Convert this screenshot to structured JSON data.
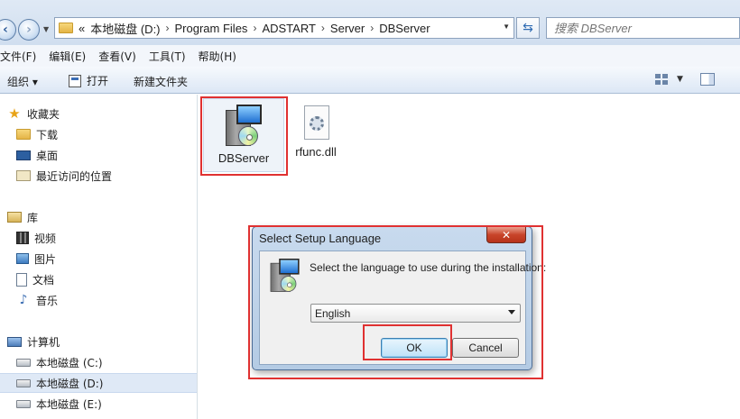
{
  "address_bar": {
    "overflow_chevron": "«",
    "crumbs": [
      "本地磁盘 (D:)",
      "Program Files",
      "ADSTART",
      "Server",
      "DBServer"
    ],
    "separator": "›",
    "search_placeholder": "搜索 DBServer"
  },
  "menu": {
    "items": [
      "文件(F)",
      "编辑(E)",
      "查看(V)",
      "工具(T)",
      "帮助(H)"
    ]
  },
  "toolbar": {
    "organize": "组织 ▾",
    "open": "打开",
    "new_folder": "新建文件夹"
  },
  "sidebar": {
    "favorites": {
      "label": "收藏夹",
      "items": [
        "下载",
        "桌面",
        "最近访问的位置"
      ]
    },
    "libraries": {
      "label": "库",
      "items": [
        "视频",
        "图片",
        "文档",
        "音乐"
      ]
    },
    "computer": {
      "label": "计算机",
      "items": [
        "本地磁盘 (C:)",
        "本地磁盘 (D:)",
        "本地磁盘 (E:)"
      ],
      "selected_index": 1
    }
  },
  "files": [
    {
      "name": "DBServer",
      "icon": "setup-installer-icon"
    },
    {
      "name": "rfunc.dll",
      "icon": "dll-gear-icon"
    }
  ],
  "dialog": {
    "title": "Select Setup Language",
    "close_glyph": "✕",
    "prompt": "Select the language to use during the installation:",
    "language_selected": "English",
    "ok_label": "OK",
    "cancel_label": "Cancel"
  },
  "colors": {
    "highlight_red": "#e03131",
    "title_bar_blue": "#c8daee",
    "dialog_body": "#f0f0f0"
  }
}
